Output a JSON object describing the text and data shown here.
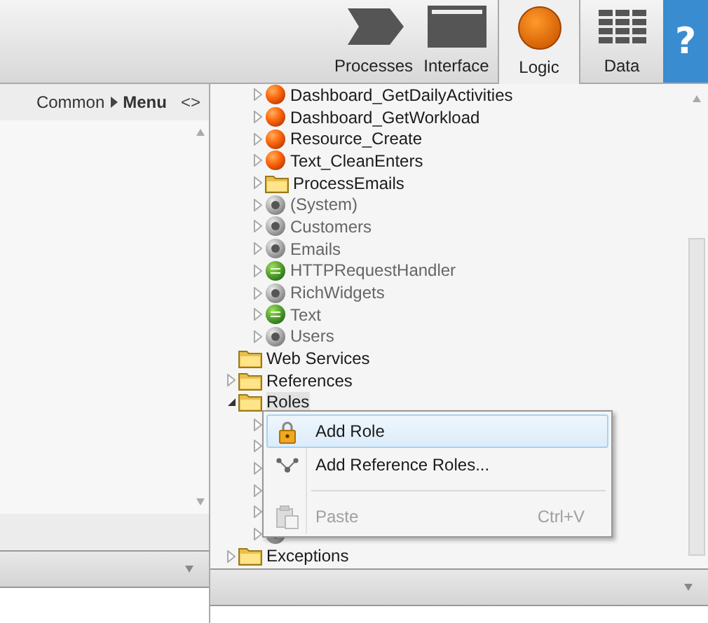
{
  "toolbar": {
    "tabs": [
      {
        "label": "Processes",
        "kind": "processes",
        "selected": false
      },
      {
        "label": "Interface",
        "kind": "interface",
        "selected": false
      },
      {
        "label": "Logic",
        "kind": "logic",
        "selected": true
      },
      {
        "label": "Data",
        "kind": "data",
        "selected": false
      }
    ],
    "help": "?"
  },
  "left_panel": {
    "breadcrumb": [
      "Common",
      "Menu"
    ],
    "toggle": "<>"
  },
  "tree": {
    "partial_branch": [
      {
        "label": "Dashboard_GetDailyActivities",
        "kind": "action",
        "expandable": true,
        "expanded": false,
        "dimmed": false
      },
      {
        "label": "Dashboard_GetWorkload",
        "kind": "action",
        "expandable": true,
        "expanded": false,
        "dimmed": false
      },
      {
        "label": "Resource_Create",
        "kind": "action",
        "expandable": true,
        "expanded": false,
        "dimmed": false
      },
      {
        "label": "Text_CleanEnters",
        "kind": "action",
        "expandable": true,
        "expanded": false,
        "dimmed": false
      },
      {
        "label": "ProcessEmails",
        "kind": "folder",
        "expandable": true,
        "expanded": false,
        "dimmed": false
      },
      {
        "label": "(System)",
        "kind": "module",
        "expandable": true,
        "expanded": false,
        "dimmed": true
      },
      {
        "label": "Customers",
        "kind": "module",
        "expandable": true,
        "expanded": false,
        "dimmed": true
      },
      {
        "label": "Emails",
        "kind": "module",
        "expandable": true,
        "expanded": false,
        "dimmed": true
      },
      {
        "label": "HTTPRequestHandler",
        "kind": "extension",
        "expandable": true,
        "expanded": false,
        "dimmed": true
      },
      {
        "label": "RichWidgets",
        "kind": "module",
        "expandable": true,
        "expanded": false,
        "dimmed": true
      },
      {
        "label": "Text",
        "kind": "extension",
        "expandable": true,
        "expanded": false,
        "dimmed": true
      },
      {
        "label": "Users",
        "kind": "module",
        "expandable": true,
        "expanded": false,
        "dimmed": true
      }
    ],
    "items": [
      {
        "label": "Web Services",
        "kind": "folder",
        "expandable": false,
        "expanded": false,
        "dimmed": false
      },
      {
        "label": "References",
        "kind": "folder",
        "expandable": true,
        "expanded": false,
        "dimmed": false
      },
      {
        "label": "Roles",
        "kind": "folder",
        "expandable": true,
        "expanded": true,
        "dimmed": false,
        "children": [
          {
            "expandable": true,
            "expanded": false
          },
          {
            "expandable": true,
            "expanded": false
          },
          {
            "expandable": true,
            "expanded": false
          },
          {
            "expandable": true,
            "expanded": false
          },
          {
            "expandable": true,
            "expanded": false
          },
          {
            "kind": "module",
            "expandable": true,
            "expanded": false
          }
        ]
      },
      {
        "label": "Exceptions",
        "kind": "folder",
        "expandable": true,
        "expanded": false,
        "dimmed": false
      }
    ]
  },
  "context_menu": {
    "items": [
      {
        "kind": "role",
        "label": "Add Role",
        "highlighted": true,
        "disabled": false
      },
      {
        "kind": "reference",
        "label": "Add Reference Roles...",
        "highlighted": false,
        "disabled": false
      },
      {
        "kind": "separator"
      },
      {
        "kind": "paste",
        "label": "Paste",
        "shortcut": "Ctrl+V",
        "highlighted": false,
        "disabled": true
      }
    ]
  }
}
